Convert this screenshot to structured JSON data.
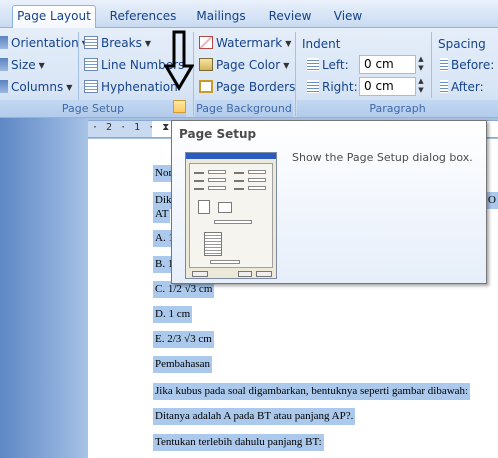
{
  "tabs": [
    {
      "label": "Page Layout",
      "active": true
    },
    {
      "label": "References"
    },
    {
      "label": "Mailings"
    },
    {
      "label": "Review"
    },
    {
      "label": "View"
    }
  ],
  "page_setup": {
    "orientation": "Orientation",
    "size": "Size",
    "columns": "Columns",
    "breaks": "Breaks",
    "line_numbers": "Line Numbers",
    "hyphenation": "Hyphenation",
    "group_label": "Page Setup"
  },
  "page_background": {
    "watermark": "Watermark",
    "page_color": "Page Color",
    "page_borders": "Page Borders",
    "group_label": "Page Background"
  },
  "paragraph": {
    "indent_label": "Indent",
    "left_label": "Left:",
    "left_value": "0 cm",
    "right_label": "Right:",
    "right_value": "0 cm",
    "spacing_label": "Spacing",
    "before_label": "Before:",
    "after_label": "After:",
    "group_label": "Paragraph"
  },
  "ruler": {
    "text": "· 2 · 1 · ⧗ · 1 · 2"
  },
  "tooltip": {
    "title": "Page Setup",
    "description": "Show the Page Setup dialog box."
  },
  "document": {
    "lines": [
      "Nom",
      "Dik",
      "AT",
      "A. 1",
      "B. 1",
      "C. 1/2 √3 cm",
      "D. 1 cm",
      "E. 2/3 √3 cm",
      " Pembahasan",
      "Jika kubus pada soal digambarkan, bentuknya seperti gambar dibawah:",
      "Ditanya adalah A pada BT atau panjang AP?.",
      "Tentukan terlebih dahulu panjang BT:"
    ],
    "right_fragment": "O"
  },
  "colors": {
    "accent": "#15428b",
    "selection": "#abc9ec",
    "ribbon": "#dbe6f4"
  },
  "icons": [
    "down-arrow-annotation-icon",
    "dialog-launcher-icon",
    "orientation-icon",
    "size-icon",
    "columns-icon",
    "breaks-icon",
    "line-numbers-icon",
    "hyphenation-icon",
    "watermark-icon",
    "page-color-icon",
    "page-borders-icon"
  ]
}
